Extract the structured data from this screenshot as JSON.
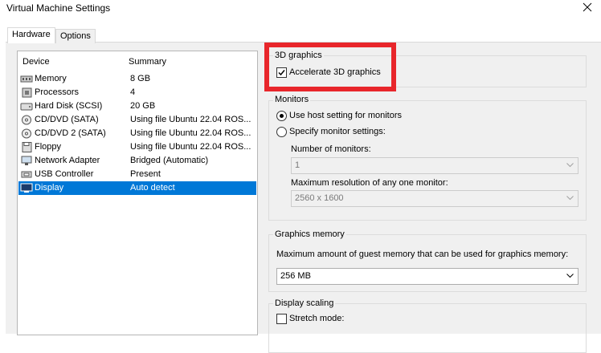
{
  "window": {
    "title": "Virtual Machine Settings"
  },
  "tabs": [
    {
      "label": "Hardware"
    },
    {
      "label": "Options"
    }
  ],
  "devices": {
    "header_device": "Device",
    "header_summary": "Summary",
    "items": [
      {
        "name": "Memory",
        "summary": "8 GB",
        "icon": "memory-icon"
      },
      {
        "name": "Processors",
        "summary": "4",
        "icon": "processor-icon"
      },
      {
        "name": "Hard Disk (SCSI)",
        "summary": "20 GB",
        "icon": "hard-disk-icon"
      },
      {
        "name": "CD/DVD (SATA)",
        "summary": "Using file Ubuntu 22.04 ROS...",
        "icon": "cd-dvd-icon"
      },
      {
        "name": "CD/DVD 2 (SATA)",
        "summary": "Using file Ubuntu 22.04 ROS...",
        "icon": "cd-dvd-icon"
      },
      {
        "name": "Floppy",
        "summary": "Using file Ubuntu 22.04 ROS...",
        "icon": "floppy-icon"
      },
      {
        "name": "Network Adapter",
        "summary": "Bridged (Automatic)",
        "icon": "network-adapter-icon"
      },
      {
        "name": "USB Controller",
        "summary": "Present",
        "icon": "usb-icon"
      },
      {
        "name": "Display",
        "summary": "Auto detect",
        "icon": "display-icon",
        "selected": true
      }
    ]
  },
  "graphics3d": {
    "group_label": "3D graphics",
    "accelerate_label": "Accelerate 3D graphics",
    "accelerate_checked": true
  },
  "monitors": {
    "group_label": "Monitors",
    "use_host_label": "Use host setting for monitors",
    "specify_label": "Specify monitor settings:",
    "selected": "use_host",
    "num_monitors_label": "Number of monitors:",
    "num_monitors_value": "1",
    "max_res_label": "Maximum resolution of any one monitor:",
    "max_res_value": "2560 x 1600"
  },
  "graphics_memory": {
    "group_label": "Graphics memory",
    "description": "Maximum amount of guest memory that can be used for graphics memory:",
    "value": "256 MB"
  },
  "display_scaling": {
    "group_label": "Display scaling",
    "stretch_label": "Stretch mode:"
  },
  "colors": {
    "selection": "#0078d7",
    "highlight_box": "#e8262b"
  }
}
